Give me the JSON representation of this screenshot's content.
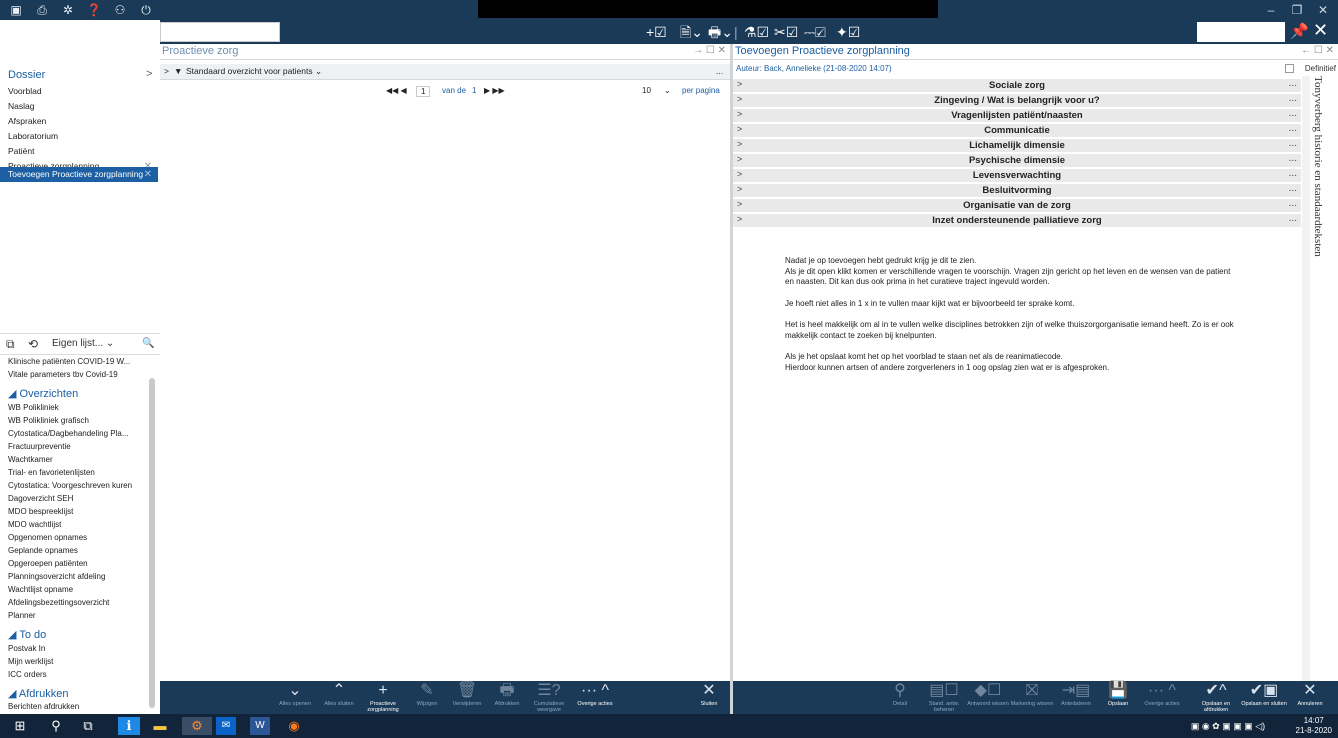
{
  "titlebar": {
    "icons": [
      "app-icon",
      "document-icon",
      "gear-icon",
      "help-icon",
      "users-icon",
      "power-icon"
    ],
    "glyphs": [
      "▣",
      "⎙",
      "✲",
      "❓",
      "⚇",
      "⏻"
    ],
    "minimize": "–",
    "maximize": "❐",
    "close": "✕"
  },
  "toolbar": {
    "glyphs": [
      "+☑",
      "🗎⌄",
      "🖶⌄",
      "|",
      "⚗☑",
      "✂☑",
      "⎓☑",
      "✦☑"
    ],
    "pin": "📌",
    "close": "✕"
  },
  "leftnav": {
    "dossier": "Dossier",
    "chevron": ">",
    "items": [
      {
        "label": "Voorblad",
        "closable": false
      },
      {
        "label": "Naslag",
        "closable": false
      },
      {
        "label": "Afspraken",
        "closable": false
      },
      {
        "label": "Laboratorium",
        "closable": false
      },
      {
        "label": "Patiënt",
        "closable": false
      },
      {
        "label": "Proactieve zorgplanning",
        "closable": true
      },
      {
        "label": "Toevoegen Proactieve zorgplanning",
        "closable": true,
        "active": true
      }
    ],
    "close_glyph": "✕"
  },
  "lists": {
    "tab_icon": "⧉",
    "history_icon": "⟲",
    "dropdown_label": "Eigen lijst... ⌄",
    "search_glyph": "🔍",
    "top_items": [
      "Klinische patiënten COVID-19 W...",
      "Vitale parameters tbv Covid-19"
    ],
    "overzichten_title": "◢ Overzichten",
    "overzichten": [
      "WB Polikliniek",
      "WB Polikliniek grafisch",
      "Cytostatica/Dagbehandeling Pla...",
      "Fractuurpreventie",
      "Wachtkamer",
      "Trial- en favorietenlijsten",
      "Cytostatica: Voorgeschreven kuren",
      "Dagoverzicht SEH",
      "MDO bespreeklijst",
      "MDO wachtlijst",
      "Opgenomen opnames",
      "Geplande opnames",
      "Opgeroepen patiënten",
      "Planningsoverzicht afdeling",
      "Wachtlijst opname",
      "Afdelingsbezettingsoverzicht",
      "Planner"
    ],
    "todo_title": "◢ To do",
    "todo": [
      "Postvak In",
      "Mijn werklijst",
      "ICC orders"
    ],
    "afdrukken_title": "◢ Afdrukken",
    "afdrukken": [
      "Berichten afdrukken"
    ]
  },
  "middle": {
    "title": "Proactieve zorg",
    "controls": "→ ☐ ✕",
    "filter_chev": ">",
    "filter_icon": "▼",
    "filter_label": "Standaard overzicht voor patients ⌄",
    "filter_more": "...",
    "pager": {
      "nav_left": "◀◀ ◀",
      "page": "1",
      "of_label": "van de",
      "total": "1",
      "nav_right": "▶ ▶▶",
      "per_page": "10",
      "per_page_label": "per pagina"
    },
    "actions": [
      {
        "icon": "⌄",
        "label": "Alles openen",
        "on": false
      },
      {
        "icon": "⌃",
        "label": "Alles sluiten",
        "on": false
      },
      {
        "icon": "+",
        "label": "Proactieve zorgplanning",
        "on": true
      },
      {
        "icon": "✎",
        "label": "Wijzigen",
        "on": false
      },
      {
        "icon": "🗑",
        "label": "Verwijderen",
        "on": false
      },
      {
        "icon": "🖶",
        "label": "Afdrukken",
        "on": false
      },
      {
        "icon": "☰?",
        "label": "Cumulatieve weergave",
        "on": false
      },
      {
        "icon": "··· ^",
        "label": "Overige acties",
        "on": true
      },
      {
        "icon": "✕",
        "label": "Sluiten",
        "on": true
      }
    ]
  },
  "right": {
    "title": "Toevoegen Proactieve zorgplanning",
    "controls": "← ☐ ✕",
    "author": "Auteur: Back, Annelieke (21-08-2020 14:07)",
    "definitief": "Definitief",
    "side_tab": "Tonyverberg historie en standaardteksten",
    "sections": [
      "Sociale zorg",
      "Zingeving / Wat is belangrijk voor u?",
      "Vragenlijsten patiënt/naasten",
      "Communicatie",
      "Lichamelijk dimensie",
      "Psychische dimensie",
      "Levensverwachting",
      "Besluitvorming",
      "Organisatie van de zorg",
      "Inzet ondersteunende palliatieve zorg"
    ],
    "section_chev": ">",
    "section_dots": "...",
    "body": [
      "Nadat je op toevoegen hebt gedrukt krijg je dit te zien.",
      "Als je dit open klikt komen er verschillende vragen te voorschijn. Vragen zijn gericht op het leven en de wensen van de patient en naasten. Dit kan dus ook prima in het curatieve traject ingevuld worden.",
      "Je hoeft niet alles in 1 x in te vullen maar kijkt wat er bijvoorbeeld ter sprake komt.",
      "Het is heel makkelijk om al in te vullen welke disciplines betrokken zijn of welke thuiszorgorganisatie iemand heeft. Zo is er ook makkelijk contact te zoeken bij knelpunten.",
      "Als je het opslaat komt het op het voorblad te staan net als de reanimatiecode.",
      "Hierdoor kunnen artsen of andere zorgverleners in 1 oog opslag zien wat er is afgesproken."
    ],
    "actions": [
      {
        "icon": "⚲",
        "label": "Detail",
        "on": false
      },
      {
        "icon": "▤☐",
        "label": "Stand. antw. beheren",
        "on": false
      },
      {
        "icon": "◆☐",
        "label": "Antwoord wissen",
        "on": false
      },
      {
        "icon": "⛝",
        "label": "Markering wissen",
        "on": false
      },
      {
        "icon": "⇥▤",
        "label": "Antedateren",
        "on": false
      },
      {
        "icon": "💾",
        "label": "Opslaan",
        "on": true
      },
      {
        "icon": "··· ^",
        "label": "Overige acties",
        "on": false
      },
      {
        "icon": "✔^",
        "label": "Opslaan en afdrukken",
        "on": true
      },
      {
        "icon": "✔▣",
        "label": "Opslaan en sluiten",
        "on": true
      },
      {
        "icon": "✕",
        "label": "Annuleren",
        "on": true
      }
    ]
  },
  "taskbar": {
    "icons": [
      "⊞",
      "⚲",
      "⧉",
      "ℹ",
      "▬",
      "⚙",
      "✉",
      "W",
      "◉"
    ],
    "tray": "▣ ◉ ✿ ▣ ▣ ▣ ◁)",
    "time": "14:07",
    "date": "21-8-2020"
  }
}
